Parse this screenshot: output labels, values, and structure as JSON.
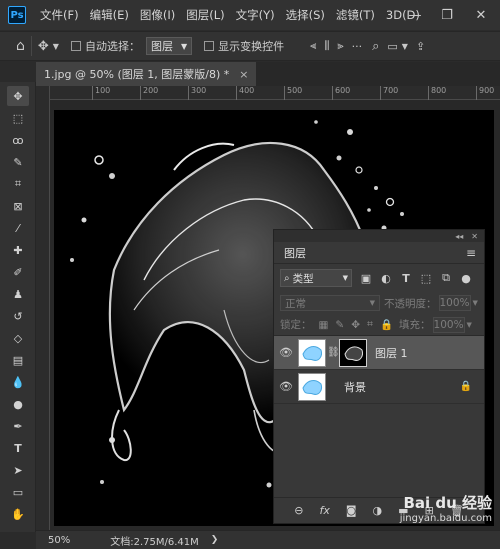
{
  "app": {
    "logo": "Ps"
  },
  "menu": [
    "文件(F)",
    "编辑(E)",
    "图像(I)",
    "图层(L)",
    "文字(Y)",
    "选择(S)",
    "滤镜(T)",
    "3D(D)"
  ],
  "options": {
    "auto_select_label": "自动选择：",
    "auto_select_value": "图层",
    "show_transform_label": "显示变换控件"
  },
  "document": {
    "tab_title": "1.jpg @ 50% (图层 1, 图层蒙版/8) *",
    "close": "×"
  },
  "rulers": {
    "horizontal": [
      "100",
      "200",
      "300",
      "400",
      "500",
      "600",
      "700",
      "800",
      "900"
    ]
  },
  "layers_panel": {
    "title": "图层",
    "filter_label": "类型",
    "blend_mode": "正常",
    "opacity_label": "不透明度：",
    "opacity_value": "100%",
    "lock_label": "锁定：",
    "fill_label": "填充：",
    "fill_value": "100%",
    "layers": [
      {
        "name": "图层 1",
        "selected": true
      },
      {
        "name": "背景",
        "selected": false
      }
    ],
    "bottom_icons": [
      "link-icon",
      "fx-icon",
      "mask-icon",
      "adjustment-icon",
      "folder-icon",
      "new-layer-icon",
      "trash-icon"
    ]
  },
  "status": {
    "zoom": "50%",
    "doc_size": "文档:2.75M/6.41M"
  },
  "watermark": {
    "brand": "Bai du 经验",
    "url": "jingyan.baidu.com"
  },
  "colors": {
    "accent": "#31a8ff",
    "canvas_bg": "#000000",
    "ui_bg": "#323232"
  }
}
